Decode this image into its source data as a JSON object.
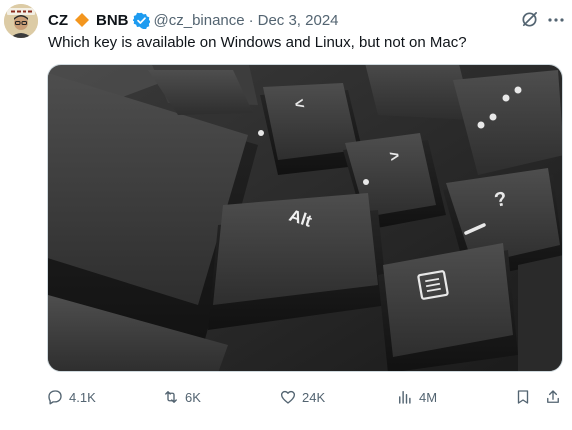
{
  "author": {
    "display_name": "CZ",
    "badge_text": "BNB",
    "handle": "@cz_binance",
    "separator": "·",
    "date": "Dec 3, 2024"
  },
  "tweet": {
    "text": "Which key is available on Windows and Linux, but not on Mac?"
  },
  "media": {
    "key_labels": {
      "alt": "Alt",
      "question": "?",
      "slash": "/",
      "greater": ">",
      "less": "<"
    }
  },
  "actions": {
    "replies": "4.1K",
    "reposts": "6K",
    "likes": "24K",
    "views": "4M"
  },
  "colors": {
    "text_primary": "#0f1419",
    "text_secondary": "#536471",
    "verified_blue": "#1d9bf0",
    "bnb_orange": "#f3961e"
  },
  "icons": [
    "grok-icon",
    "reply-icon",
    "retweet-icon",
    "like-icon",
    "views-icon",
    "bookmark-icon",
    "share-icon",
    "verified-icon",
    "bnb-diamond-icon"
  ]
}
